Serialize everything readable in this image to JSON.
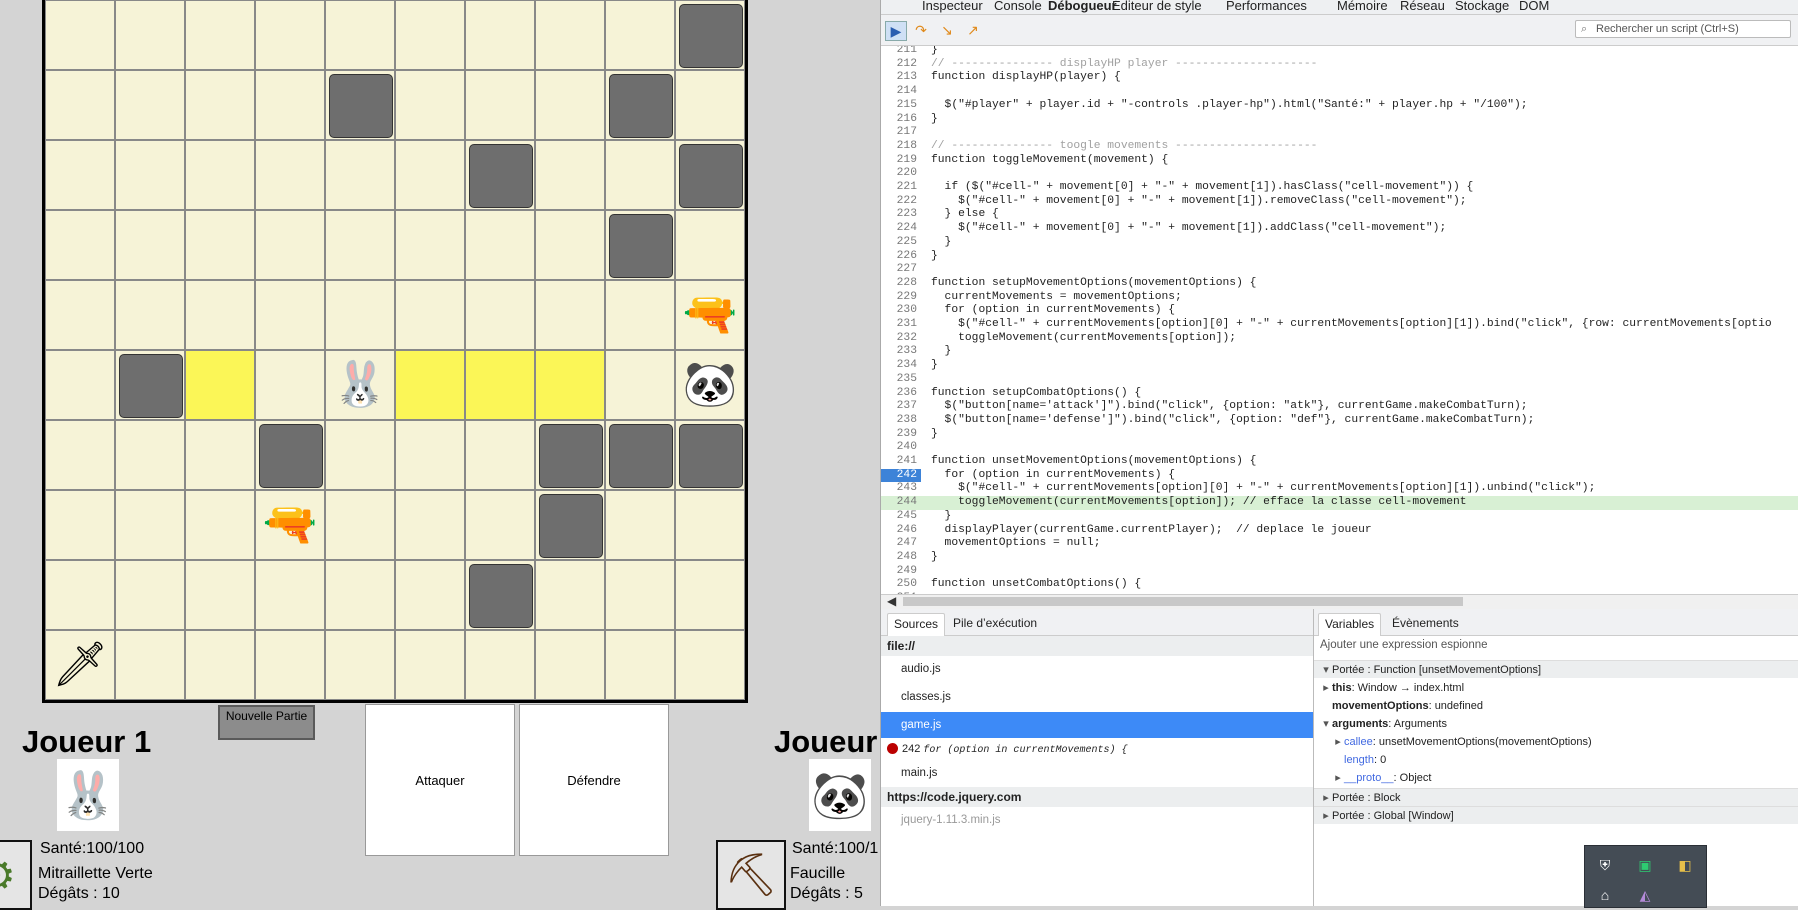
{
  "game": {
    "board": {
      "rocks": [
        [
          0,
          9
        ],
        [
          1,
          4
        ],
        [
          1,
          8
        ],
        [
          2,
          6
        ],
        [
          2,
          9
        ],
        [
          3,
          8
        ],
        [
          5,
          1
        ],
        [
          6,
          3
        ],
        [
          6,
          7
        ],
        [
          6,
          8
        ],
        [
          6,
          9
        ],
        [
          7,
          7
        ],
        [
          8,
          6
        ]
      ],
      "movement_cells": [
        [
          5,
          2
        ],
        [
          5,
          5
        ],
        [
          5,
          6
        ],
        [
          5,
          7
        ]
      ],
      "items": [
        {
          "row": 4,
          "col": 9,
          "icon": "weapon-cannon-icon",
          "glyph": "🔫"
        },
        {
          "row": 5,
          "col": 4,
          "icon": "bunny-player-icon",
          "glyph": "🐰"
        },
        {
          "row": 5,
          "col": 9,
          "icon": "panda-player-icon",
          "glyph": "🐼"
        },
        {
          "row": 7,
          "col": 3,
          "icon": "pistol-icon",
          "glyph": "🔫"
        },
        {
          "row": 9,
          "col": 0,
          "icon": "dagger-icon",
          "glyph": "🗡"
        }
      ]
    },
    "new_game_button": "Nouvelle Partie",
    "attack_button": "Attaquer",
    "defense_button": "Défendre",
    "player1": {
      "name": "Joueur 1",
      "avatar_glyph": "🐰",
      "hp": "Santé:100/100",
      "weapon_name": "Mitraillette Verte",
      "damage": "Dégâts : 10",
      "weapon_glyph": "⚙"
    },
    "player2": {
      "name": "Joueur",
      "avatar_glyph": "🐼",
      "hp": "Santé:100/1",
      "weapon_name": "Faucille",
      "damage": "Dégâts : 5",
      "weapon_glyph": "⛏"
    }
  },
  "devtools": {
    "tabs": [
      "Inspecteur",
      "Console",
      "Débogueur",
      "Éditeur de style",
      "Performances",
      "Mémoire",
      "Réseau",
      "Stockage",
      "DOM"
    ],
    "active_tab": "Débogueur",
    "search_placeholder": "Rechercher un script (Ctrl+S)",
    "code_lines": [
      {
        "n": "211",
        "t": "}",
        "cls": ""
      },
      {
        "n": "212",
        "t": "// --------------- displayHP player ---------------------",
        "cls": "cm"
      },
      {
        "n": "213",
        "t": "function displayHP(player) {",
        "cls": ""
      },
      {
        "n": "214",
        "t": "",
        "cls": ""
      },
      {
        "n": "215",
        "t": "  $(\"#player\" + player.id + \"-controls .player-hp\").html(\"Santé:\" + player.hp + \"/100\");",
        "cls": ""
      },
      {
        "n": "216",
        "t": "}",
        "cls": ""
      },
      {
        "n": "217",
        "t": "",
        "cls": ""
      },
      {
        "n": "218",
        "t": "// --------------- toogle movements ---------------------",
        "cls": "cm"
      },
      {
        "n": "219",
        "t": "function toggleMovement(movement) {",
        "cls": ""
      },
      {
        "n": "220",
        "t": "",
        "cls": ""
      },
      {
        "n": "221",
        "t": "  if ($(\"#cell-\" + movement[0] + \"-\" + movement[1]).hasClass(\"cell-movement\")) {",
        "cls": ""
      },
      {
        "n": "222",
        "t": "    $(\"#cell-\" + movement[0] + \"-\" + movement[1]).removeClass(\"cell-movement\");",
        "cls": ""
      },
      {
        "n": "223",
        "t": "  } else {",
        "cls": ""
      },
      {
        "n": "224",
        "t": "    $(\"#cell-\" + movement[0] + \"-\" + movement[1]).addClass(\"cell-movement\");",
        "cls": ""
      },
      {
        "n": "225",
        "t": "  }",
        "cls": ""
      },
      {
        "n": "226",
        "t": "}",
        "cls": ""
      },
      {
        "n": "227",
        "t": "",
        "cls": ""
      },
      {
        "n": "228",
        "t": "function setupMovementOptions(movementOptions) {",
        "cls": ""
      },
      {
        "n": "229",
        "t": "  currentMovements = movementOptions;",
        "cls": ""
      },
      {
        "n": "230",
        "t": "  for (option in currentMovements) {",
        "cls": ""
      },
      {
        "n": "231",
        "t": "    $(\"#cell-\" + currentMovements[option][0] + \"-\" + currentMovements[option][1]).bind(\"click\", {row: currentMovements[optio",
        "cls": ""
      },
      {
        "n": "232",
        "t": "    toggleMovement(currentMovements[option]);",
        "cls": ""
      },
      {
        "n": "233",
        "t": "  }",
        "cls": ""
      },
      {
        "n": "234",
        "t": "}",
        "cls": ""
      },
      {
        "n": "235",
        "t": "",
        "cls": ""
      },
      {
        "n": "236",
        "t": "function setupCombatOptions() {",
        "cls": ""
      },
      {
        "n": "237",
        "t": "  $(\"button[name='attack']\").bind(\"click\", {option: \"atk\"}, currentGame.makeCombatTurn);",
        "cls": ""
      },
      {
        "n": "238",
        "t": "  $(\"button[name='defense']\").bind(\"click\", {option: \"def\"}, currentGame.makeCombatTurn);",
        "cls": ""
      },
      {
        "n": "239",
        "t": "}",
        "cls": ""
      },
      {
        "n": "240",
        "t": "",
        "cls": ""
      },
      {
        "n": "241",
        "t": "function unsetMovementOptions(movementOptions) {",
        "cls": ""
      },
      {
        "n": "242",
        "t": "  for (option in currentMovements) {",
        "cls": "bp"
      },
      {
        "n": "243",
        "t": "    $(\"#cell-\" + currentMovements[option][0] + \"-\" + currentMovements[option][1]).unbind(\"click\");",
        "cls": ""
      },
      {
        "n": "244",
        "t": "    toggleMovement(currentMovements[option]); // efface la classe cell-movement",
        "cls": "cur"
      },
      {
        "n": "245",
        "t": "  }",
        "cls": ""
      },
      {
        "n": "246",
        "t": "  displayPlayer(currentGame.currentPlayer);  // deplace le joueur",
        "cls": ""
      },
      {
        "n": "247",
        "t": "  movementOptions = null;",
        "cls": ""
      },
      {
        "n": "248",
        "t": "}",
        "cls": ""
      },
      {
        "n": "249",
        "t": "",
        "cls": ""
      },
      {
        "n": "250",
        "t": "function unsetCombatOptions() {",
        "cls": ""
      },
      {
        "n": "251",
        "t": "",
        "cls": ""
      }
    ],
    "sources_panel": {
      "tabs": [
        "Sources",
        "Pile d’exécution"
      ],
      "group1": "file://",
      "files1": [
        "audio.js",
        "classes.js",
        "game.js"
      ],
      "selected_file": "game.js",
      "breakpoint_line": "242",
      "breakpoint_code": "for (option in currentMovements) {",
      "file_main": "main.js",
      "group2": "https://code.jquery.com",
      "file_jquery": "jquery-1.11.3.min.js"
    },
    "vars_panel": {
      "tabs": [
        "Variables",
        "Évènements"
      ],
      "watch_placeholder": "Ajouter une expression espionne",
      "scope_function": "Portée : Function [unsetMovementOptions]",
      "this_label": "this",
      "this_value": ": Window → index.html",
      "movement_label": "movementOptions",
      "movement_value": ": undefined",
      "arguments_label": "arguments",
      "arguments_value": ": Arguments",
      "callee_label": "callee",
      "callee_value": ": unsetMovementOptions(movementOptions)",
      "length_label": "length",
      "length_value": ": 0",
      "proto_label": "__proto__",
      "proto_value": ": Object",
      "scope_block": "Portée : Block",
      "scope_global": "Portée : Global [Window]"
    }
  }
}
